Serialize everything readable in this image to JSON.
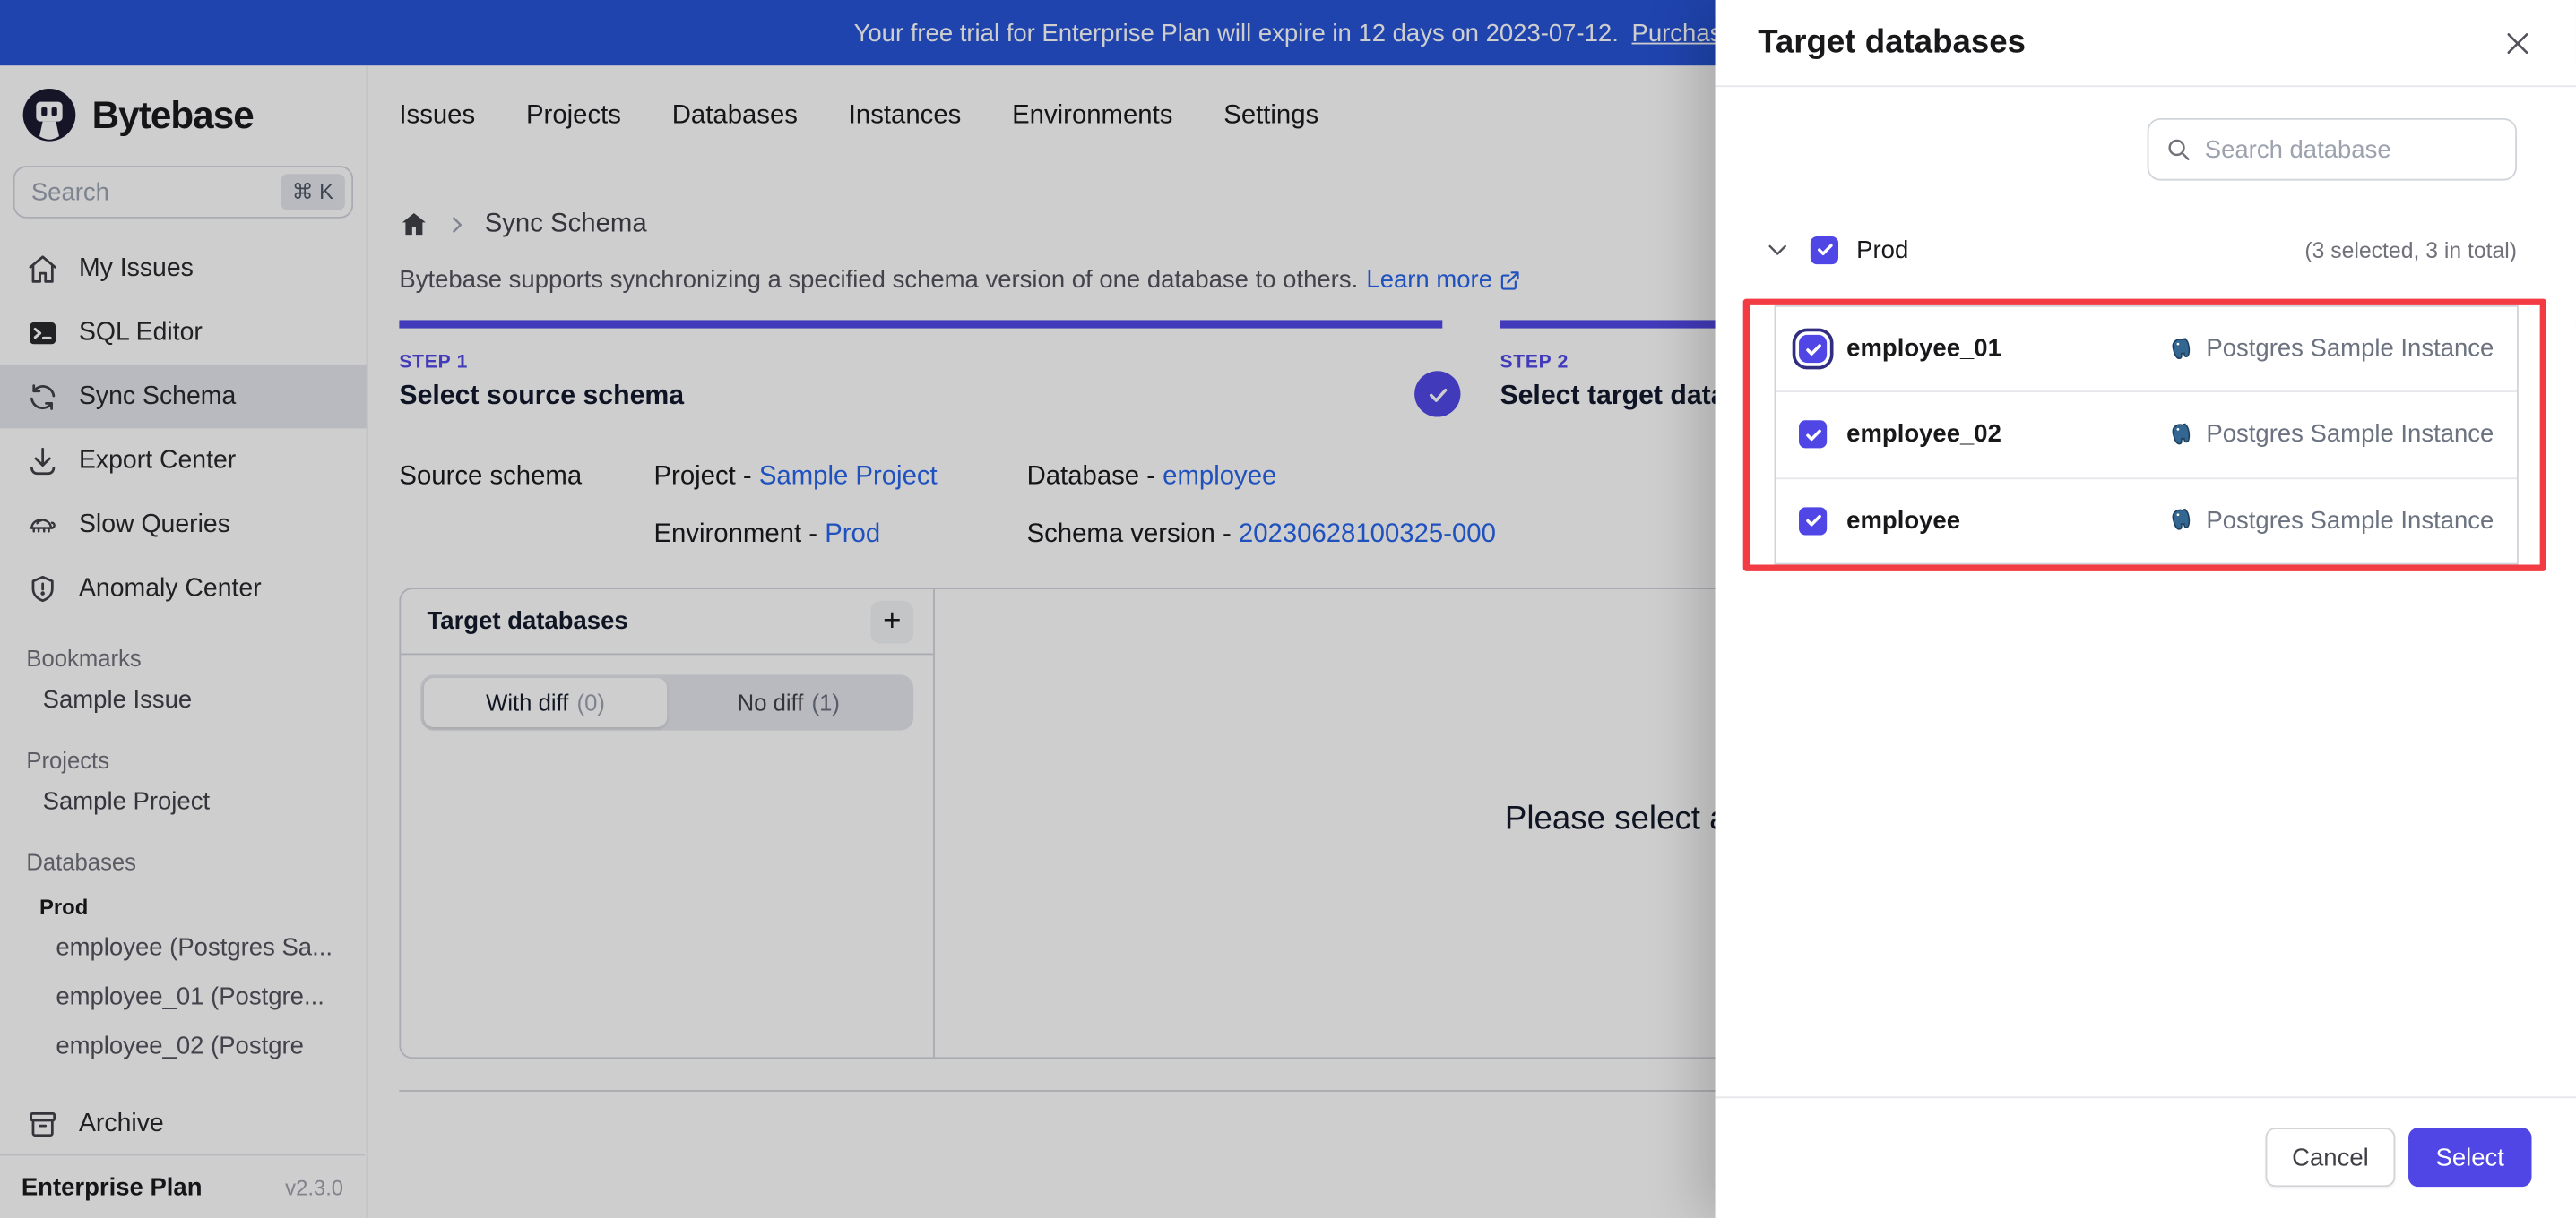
{
  "banner": {
    "text": "Your free trial for Enterprise Plan will expire in 12 days on 2023-07-12.",
    "link_label": "Purchas"
  },
  "sidebar": {
    "brand": "Bytebase",
    "search": {
      "placeholder": "Search",
      "shortcut": "⌘ K"
    },
    "nav": [
      {
        "label": "My Issues",
        "icon": "home-icon"
      },
      {
        "label": "SQL Editor",
        "icon": "terminal-icon"
      },
      {
        "label": "Sync Schema",
        "icon": "sync-icon",
        "active": true
      },
      {
        "label": "Export Center",
        "icon": "download-icon"
      },
      {
        "label": "Slow Queries",
        "icon": "turtle-icon"
      },
      {
        "label": "Anomaly Center",
        "icon": "shield-icon"
      }
    ],
    "bookmarks": {
      "title": "Bookmarks",
      "items": [
        "Sample Issue"
      ]
    },
    "projects": {
      "title": "Projects",
      "items": [
        "Sample Project"
      ]
    },
    "databases": {
      "title": "Databases",
      "group": "Prod",
      "items": [
        "employee (Postgres Sa...",
        "employee_01 (Postgre...",
        "employee_02 (Postgre"
      ]
    },
    "archive_label": "Archive",
    "footer": {
      "plan": "Enterprise Plan",
      "version": "v2.3.0"
    }
  },
  "topnav": {
    "items": [
      "Issues",
      "Projects",
      "Databases",
      "Instances",
      "Environments",
      "Settings"
    ]
  },
  "main": {
    "breadcrumb": {
      "page": "Sync Schema"
    },
    "description": {
      "text": "Bytebase supports synchronizing a specified schema version of one database to others.",
      "link_label": "Learn more"
    },
    "steps": [
      {
        "label": "STEP 1",
        "title": "Select source schema",
        "completed": true
      },
      {
        "label": "STEP 2",
        "title": "Select target datab"
      }
    ],
    "source_schema": {
      "label": "Source schema",
      "separator": " - ",
      "fields": [
        {
          "name": "Project",
          "value": "Sample Project"
        },
        {
          "name": "Database",
          "value": "employee"
        },
        {
          "name": "Environment",
          "value": "Prod"
        },
        {
          "name": "Schema version",
          "value": "20230628100325-000"
        }
      ]
    },
    "panel": {
      "title": "Target databases",
      "add_label": "+",
      "tabs": [
        {
          "label": "With diff",
          "count": "(0)",
          "active": true
        },
        {
          "label": "No diff",
          "count": "(1)"
        }
      ]
    },
    "empty_hint": "Please select a t"
  },
  "drawer": {
    "title": "Target databases",
    "search_placeholder": "Search database",
    "group": {
      "label": "Prod",
      "summary": "(3 selected, 3 in total)",
      "checked": true
    },
    "databases": [
      {
        "name": "employee_01",
        "instance": "Postgres Sample Instance",
        "checked": true,
        "focused": true
      },
      {
        "name": "employee_02",
        "instance": "Postgres Sample Instance",
        "checked": true
      },
      {
        "name": "employee",
        "instance": "Postgres Sample Instance",
        "checked": true
      }
    ],
    "actions": {
      "cancel": "Cancel",
      "select": "Select"
    }
  },
  "colors": {
    "accent": "#4f46e5",
    "link": "#2563eb",
    "banner_blue": "#2553d6",
    "annotation_red": "#f23b43",
    "postgres_blue": "#336791"
  }
}
